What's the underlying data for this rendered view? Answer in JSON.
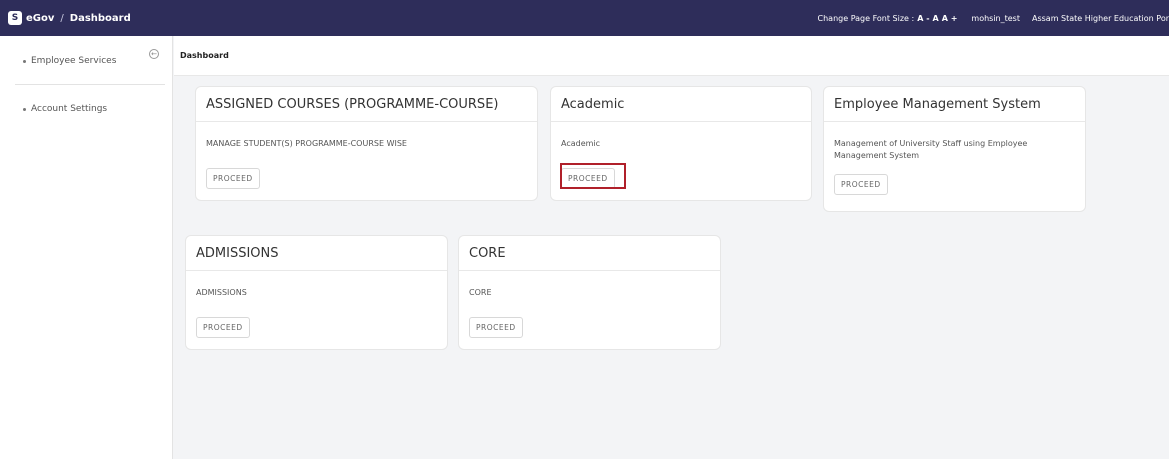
{
  "topbar": {
    "logo_letter": "S",
    "brand": "eGov",
    "separator": "/",
    "page": "Dashboard",
    "font_size_label": "Change Page Font Size :",
    "font_decrease": "A -",
    "font_normal": "A",
    "font_increase": "A +",
    "user": "mohsin_test",
    "organization": "Assam State Higher Education Por"
  },
  "sidebar": {
    "items": [
      {
        "label": "Employee Services"
      },
      {
        "label": "Account Settings"
      }
    ]
  },
  "header": {
    "title": "Dashboard"
  },
  "cards": [
    {
      "title": "ASSIGNED COURSES (PROGRAMME-COURSE)",
      "description": "MANAGE STUDENT(S) PROGRAMME-COURSE WISE",
      "button": "PROCEED"
    },
    {
      "title": "Academic",
      "description": "Academic",
      "button": "PROCEED"
    },
    {
      "title": "Employee Management System",
      "description": "Management of University Staff using Employee Management System",
      "button": "PROCEED"
    },
    {
      "title": "ADMISSIONS",
      "description": "ADMISSIONS",
      "button": "PROCEED"
    },
    {
      "title": "CORE",
      "description": "CORE",
      "button": "PROCEED"
    }
  ],
  "colors": {
    "topbar": "#2e2d5a",
    "highlight": "#b0202a"
  }
}
